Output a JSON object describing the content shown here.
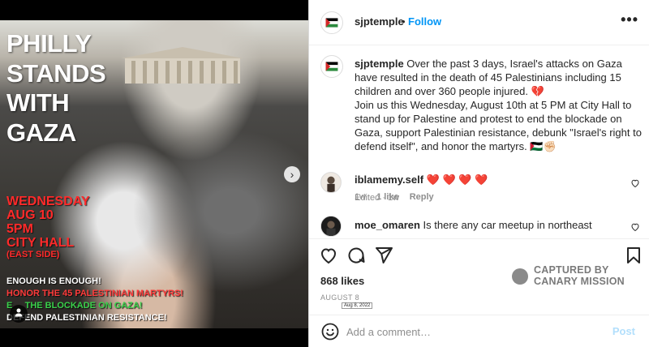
{
  "media": {
    "headline": [
      "PHILLY",
      "STANDS",
      "WITH",
      "GAZA"
    ],
    "event": [
      "WEDNESDAY",
      "AUG 10",
      "5PM",
      "CITY HALL"
    ],
    "event_note": "(EAST SIDE)",
    "slogans": [
      "ENOUGH IS ENOUGH!",
      "HONOR THE 45 PALESTINIAN MARTYRS!",
      "E__ THE BLOCKADE ON GAZA!",
      "DEFEND PALESTINIAN RESISTANCE!"
    ],
    "next_icon": "›",
    "tag_icon": "person-icon"
  },
  "header": {
    "username": "sjptemple",
    "dot": "•",
    "follow_label": "Follow",
    "more_icon": "•••"
  },
  "caption": {
    "username": "sjptemple",
    "text_1": " Over the past 3 days, Israel's attacks on Gaza have resulted in the death of 45 Palestinians including 15 children and over 360 people injured. 💔",
    "text_2": "Join us this Wednesday, August 10th at 5 PM at City Hall to stand up for Palestine and protest to end the blockade on Gaza, support Palestinian resistance, debunk \"Israel's right to defend itself\", and honor the martyrs. 🇵🇸✊🏻",
    "meta": "Edited · 1w"
  },
  "comments": [
    {
      "username": "iblamemy.self",
      "text": "❤️ ❤️ ❤️ ❤️",
      "time": "1w",
      "likes": "1 like",
      "reply": "Reply"
    },
    {
      "username": "moe_omaren",
      "text": "Is there any car meetup in northeast"
    }
  ],
  "post": {
    "likes": "868 likes",
    "date": "AUGUST 8",
    "date_tooltip": "Aug 8, 2022"
  },
  "watermark": {
    "line1": "CAPTURED BY",
    "line2": "CANARY MISSION"
  },
  "add_comment": {
    "placeholder": "Add a comment…",
    "post_label": "Post"
  },
  "colors": {
    "link": "#0095f6",
    "post_disabled": "#b2dffc",
    "heart": "#ed4956"
  }
}
